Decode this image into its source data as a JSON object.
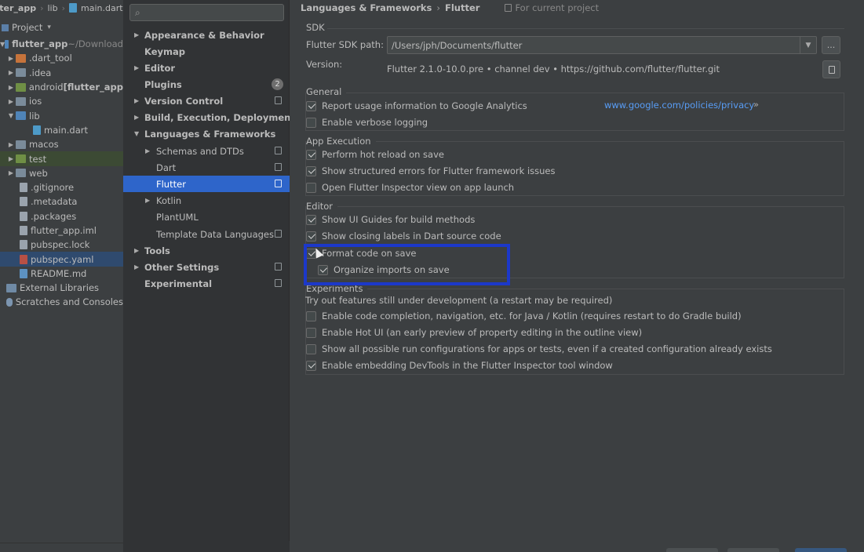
{
  "project_panel": {
    "breadcrumb": [
      "tter_app",
      "lib",
      "main.dart"
    ],
    "toolbar_label": "Project",
    "tree": [
      {
        "label": "flutter_app",
        "suffix": " ~/Download",
        "icon": "folder-icon",
        "bold": true
      },
      {
        "label": ".dart_tool",
        "icon": "folder-icon"
      },
      {
        "label": ".idea",
        "icon": "folder-icon"
      },
      {
        "label": "android",
        "suffix": " [flutter_app",
        "icon": "folder-icon"
      },
      {
        "label": "ios",
        "icon": "folder-icon"
      },
      {
        "label": "lib",
        "icon": "folder-icon"
      },
      {
        "label": "main.dart",
        "icon": "dart-file-icon"
      },
      {
        "label": "macos",
        "icon": "folder-icon"
      },
      {
        "label": "test",
        "icon": "folder-icon"
      },
      {
        "label": "web",
        "icon": "folder-icon"
      },
      {
        "label": ".gitignore",
        "icon": "file-icon"
      },
      {
        "label": ".metadata",
        "icon": "file-icon"
      },
      {
        "label": ".packages",
        "icon": "file-icon"
      },
      {
        "label": "flutter_app.iml",
        "icon": "file-icon"
      },
      {
        "label": "pubspec.lock",
        "icon": "file-icon"
      },
      {
        "label": "pubspec.yaml",
        "icon": "yaml-file-icon"
      },
      {
        "label": "README.md",
        "icon": "markdown-file-icon"
      },
      {
        "label": "External Libraries",
        "icon": "library-icon"
      },
      {
        "label": "Scratches and Consoles",
        "icon": "scratch-icon"
      }
    ]
  },
  "settings_nav": {
    "search_placeholder": "",
    "items": [
      {
        "label": "Appearance & Behavior"
      },
      {
        "label": "Keymap"
      },
      {
        "label": "Editor"
      },
      {
        "label": "Plugins",
        "badge": "2"
      },
      {
        "label": "Version Control"
      },
      {
        "label": "Build, Execution, Deployment"
      },
      {
        "label": "Languages & Frameworks"
      },
      {
        "label": "Schemas and DTDs"
      },
      {
        "label": "Dart"
      },
      {
        "label": "Flutter"
      },
      {
        "label": "Kotlin"
      },
      {
        "label": "PlantUML"
      },
      {
        "label": "Template Data Languages"
      },
      {
        "label": "Tools"
      },
      {
        "label": "Other Settings"
      },
      {
        "label": "Experimental"
      }
    ]
  },
  "breadcrumb": {
    "path": [
      "Languages & Frameworks",
      "Flutter"
    ],
    "scope": "For current project"
  },
  "sdk": {
    "group_title": "SDK",
    "path_label": "Flutter SDK path:",
    "path_value": "/Users/jph/Documents/flutter",
    "browse_label": "...",
    "version_label": "Version:",
    "version_value": "Flutter 2.1.0-10.0.pre • channel dev • https://github.com/flutter/flutter.git"
  },
  "general": {
    "group_title": "General",
    "report_usage": "Report usage information to Google Analytics",
    "privacy_link": "www.google.com/policies/privacy",
    "privacy_arrow": "»",
    "verbose_logging": "Enable verbose logging"
  },
  "app_execution": {
    "group_title": "App Execution",
    "hot_reload": "Perform hot reload on save",
    "structured_errors": "Show structured errors for Flutter framework issues",
    "open_inspector": "Open Flutter Inspector view on app launch"
  },
  "editor": {
    "group_title": "Editor",
    "ui_guides": "Show UI Guides for build methods",
    "closing_labels": "Show closing labels in Dart source code",
    "format_on_save": "Format code on save",
    "organize_imports": "Organize imports on save"
  },
  "experiments": {
    "group_title": "Experiments",
    "description": "Try out features still under development (a restart may be required)",
    "code_completion": "Enable code completion, navigation, etc. for Java / Kotlin (requires restart to do Gradle build)",
    "hot_ui": "Enable Hot UI (an early preview of property editing in the outline view)",
    "run_configs": "Show all possible run configurations for apps or tests, even if a created configuration already exists",
    "devtools": "Enable embedding DevTools in the Flutter Inspector tool window"
  },
  "colors": {
    "selection": "#2e65ca",
    "link": "#589df6",
    "highlight_box": "#1c38c9"
  }
}
